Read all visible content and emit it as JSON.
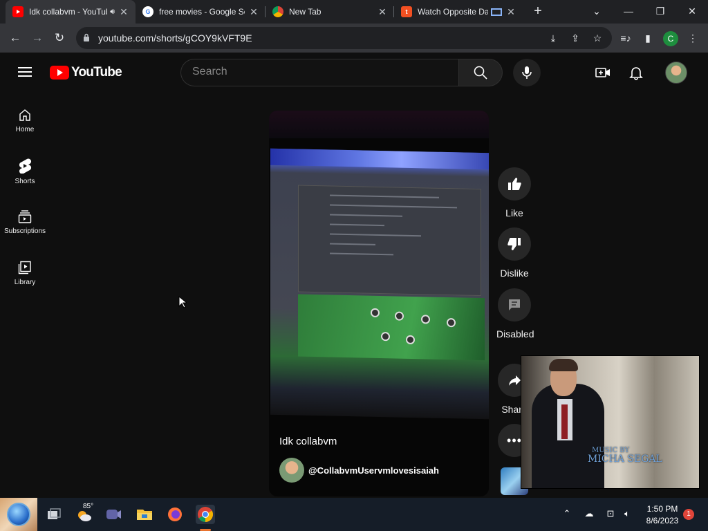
{
  "tabs": [
    {
      "title": "Idk collabvm - YouTube",
      "favicon": "youtube-favicon",
      "active": true,
      "audio": true
    },
    {
      "title": "free movies - Google Search",
      "favicon": "google-favicon",
      "active": false
    },
    {
      "title": "New Tab",
      "favicon": "chrome-favicon",
      "active": false
    },
    {
      "title": "Watch Opposite Day",
      "favicon": "tubi-favicon",
      "active": false
    }
  ],
  "omnibox": {
    "url": "youtube.com/shorts/gCOY9kVFT9E"
  },
  "masthead": {
    "logo_text": "YouTube",
    "search_placeholder": "Search"
  },
  "guide": [
    {
      "label": "Home",
      "icon": "home-icon"
    },
    {
      "label": "Shorts",
      "icon": "shorts-icon"
    },
    {
      "label": "Subscriptions",
      "icon": "subscriptions-icon"
    },
    {
      "label": "Library",
      "icon": "library-icon"
    }
  ],
  "short": {
    "title": "Idk collabvm",
    "channel": "@CollabvmUservmlovesisaiah"
  },
  "actions": {
    "like": "Like",
    "dislike": "Dislike",
    "comments": "Disabled",
    "share": "Share"
  },
  "pip": {
    "credit_line1": "MUSIC BY",
    "credit_line2": "MICHA SEGAL"
  },
  "taskbar": {
    "weather_temp": "85°",
    "time": "1:50 PM",
    "date": "8/6/2023",
    "notification_count": "1",
    "apps": [
      "task-view-icon",
      "weather-icon",
      "teams-icon",
      "file-explorer-icon",
      "firefox-icon",
      "chrome-icon"
    ]
  },
  "colors": {
    "youtube_red": "#ff0000",
    "background": "#0f0f0f",
    "chrome_frame": "#202124"
  }
}
